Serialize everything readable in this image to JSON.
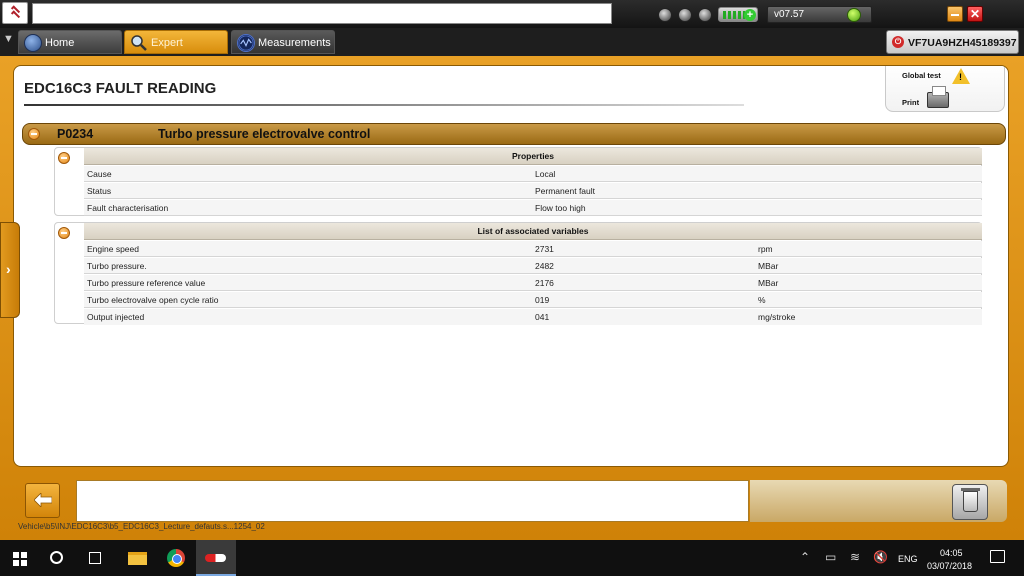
{
  "window": {
    "version": "v07.57",
    "vin": "VF7UA9HZH45189397"
  },
  "nav": {
    "tabs": [
      {
        "label": "Home"
      },
      {
        "label": "Expert"
      },
      {
        "label": "Measurements"
      }
    ],
    "active_tab": "Expert"
  },
  "page": {
    "title": "EDC16C3  FAULT READING",
    "actions": {
      "global_test_label": "Global test",
      "print_label": "Print"
    }
  },
  "fault": {
    "code": "P0234",
    "title": "Turbo pressure electrovalve control",
    "properties": {
      "header": "Properties",
      "rows": [
        {
          "label": "Cause",
          "value": "Local"
        },
        {
          "label": "Status",
          "value": "Permanent fault"
        },
        {
          "label": "Fault characterisation",
          "value": "Flow too high"
        }
      ]
    },
    "variables": {
      "header": "List of associated variables",
      "rows": [
        {
          "label": "Engine speed",
          "value": "2731",
          "unit": "rpm"
        },
        {
          "label": "Turbo pressure.",
          "value": "2482",
          "unit": "MBar"
        },
        {
          "label": "Turbo pressure reference value",
          "value": "2176",
          "unit": "MBar"
        },
        {
          "label": "Turbo electrovalve open cycle ratio",
          "value": "019",
          "unit": "%"
        },
        {
          "label": "Output injected",
          "value": "041",
          "unit": "mg/stroke"
        }
      ]
    }
  },
  "status_bar": {
    "path": "Vehicle\\b5\\INJ\\EDC16C3\\b5_EDC16C3_Lecture_defauts.s...1254_02"
  },
  "taskbar": {
    "language": "ENG",
    "time": "04:05",
    "date": "03/07/2018"
  },
  "colors": {
    "accent_orange": "#e09415",
    "fault_header": "#b3842f",
    "close_red": "#d11f1f"
  }
}
